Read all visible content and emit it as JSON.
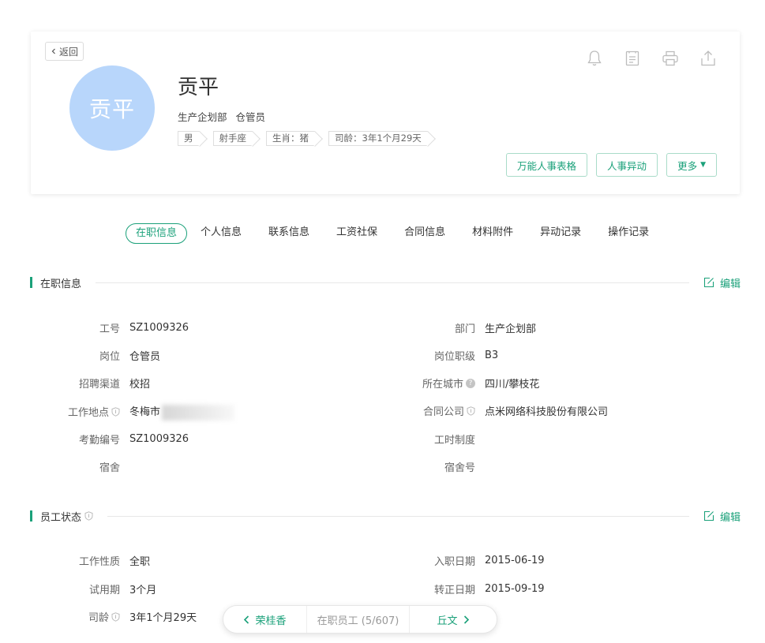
{
  "header": {
    "back_label": "返回",
    "avatar_text": "贡平",
    "name": "贡平",
    "department": "生产企划部",
    "position": "仓管员",
    "tags": [
      "男",
      "射手座",
      "生肖：猪",
      "司龄：3年1个月29天"
    ],
    "actions": {
      "universal_form": "万能人事表格",
      "transfer": "人事异动",
      "more": "更多"
    }
  },
  "tabs": [
    "在职信息",
    "个人信息",
    "联系信息",
    "工资社保",
    "合同信息",
    "材料附件",
    "异动记录",
    "操作记录"
  ],
  "sections": {
    "employment": {
      "title": "在职信息",
      "edit_label": "编辑",
      "left": [
        {
          "label": "工号",
          "value": "SZ1009326"
        },
        {
          "label": "岗位",
          "value": "仓管员"
        },
        {
          "label": "招聘渠道",
          "value": "校招"
        },
        {
          "label": "工作地点",
          "value": "冬梅市"
        },
        {
          "label": "考勤编号",
          "value": "SZ1009326"
        },
        {
          "label": "宿舍",
          "value": ""
        }
      ],
      "right": [
        {
          "label": "部门",
          "value": "生产企划部"
        },
        {
          "label": "岗位职级",
          "value": "B3"
        },
        {
          "label": "所在城市",
          "value": "四川/攀枝花"
        },
        {
          "label": "合同公司",
          "value": "点米网络科技股份有限公司"
        },
        {
          "label": "工时制度",
          "value": ""
        },
        {
          "label": "宿舍号",
          "value": ""
        }
      ]
    },
    "status": {
      "title": "员工状态",
      "edit_label": "编辑",
      "left": [
        {
          "label": "工作性质",
          "value": "全职"
        },
        {
          "label": "试用期",
          "value": "3个月"
        },
        {
          "label": "司龄",
          "value": "3年1个月29天"
        }
      ],
      "right": [
        {
          "label": "入职日期",
          "value": "2015-06-19"
        },
        {
          "label": "转正日期",
          "value": "2015-09-19"
        }
      ]
    }
  },
  "pager": {
    "prev": "荣桂香",
    "current": "在职员工 (5/607)",
    "next": "丘文"
  },
  "colors": {
    "accent": "#1ba17a",
    "avatar_bg": "#b8d6fb"
  }
}
